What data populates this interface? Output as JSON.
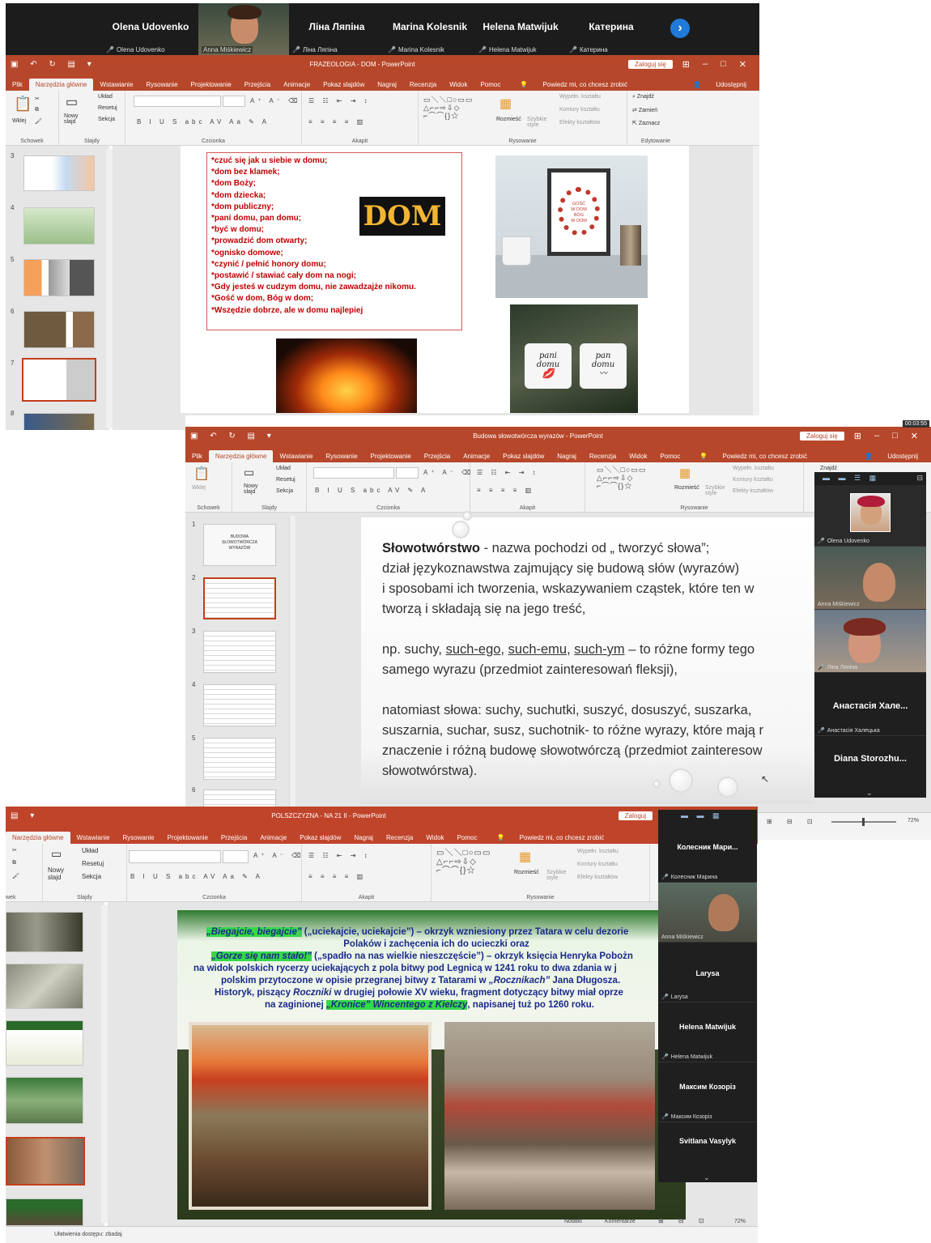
{
  "shot1": {
    "participants": [
      {
        "name": "Olena Udovenko",
        "sub": "Olena Udovenko"
      },
      {
        "name": "",
        "sub": "Anna Miśkiewicz"
      },
      {
        "name": "Ліна Ляпіна",
        "sub": "Ліна Ляпіна"
      },
      {
        "name": "Marina Kolesnik",
        "sub": "Marina Kolesnik"
      },
      {
        "name": "Helena Matwijuk",
        "sub": "Helena Matwijuk"
      },
      {
        "name": "Катерина",
        "sub": "Катерина"
      }
    ],
    "next_icon": "chevron-right-icon",
    "window_title": "FRAZEOLOGIA - DOM  -  PowerPoint",
    "login": "Zaloguj się",
    "tabs": [
      "Plik",
      "Narzędzia główne",
      "Wstawianie",
      "Rysowanie",
      "Projektowanie",
      "Przejścia",
      "Animacje",
      "Pokaz slajdów",
      "Nagraj",
      "Recenzja",
      "Widok",
      "Pomoc"
    ],
    "tell_me": "Powiedz mi, co chcesz zrobić",
    "share": "Udostępnij",
    "groups": {
      "clipboard": "Schowek",
      "slides": "Slajdy",
      "font": "Czcionka",
      "paragraph": "Akapit",
      "drawing": "Rysowanie",
      "editing": "Edytowanie"
    },
    "ribbon_items": {
      "paste": "Wklej",
      "new_slide": "Nowy slajd",
      "layout": "Układ",
      "reset": "Resetuj",
      "section": "Sekcja",
      "arrange": "Rozmieść",
      "quick_styles": "Szybkie style",
      "fill": "Wypełn. kształtu",
      "outline": "Kontury kształtu",
      "effects": "Efekty kształtów",
      "find": "Znajdź",
      "replace": "Zamień",
      "select": "Zaznacz"
    },
    "thumb_numbers": [
      "3",
      "4",
      "5",
      "6",
      "7",
      "8"
    ],
    "slide": {
      "phrases": [
        "*czuć się jak u siebie w domu;",
        "*dom bez klamek;",
        "*dom Boży;",
        "*dom dziecka;",
        "*dom publiczny;",
        "*pani domu, pan domu;",
        "*być w domu;",
        "*prowadzić dom otwarty;",
        "*ognisko domowe;",
        "*czynić / pełnić honory domu;",
        "*postawić / stawiać cały dom na nogi;",
        "*Gdy jesteś w cudzym domu, nie zawadzajże nikomu.",
        "*Gość w dom, Bóg w dom;",
        "*Wszędzie dobrze, ale w domu najlepiej"
      ],
      "logo": "DOM",
      "frame_text": [
        "GOŚĆ",
        "W DOM",
        "BÓG",
        "W DOM"
      ],
      "mug_left": [
        "pani",
        "domu"
      ],
      "mug_right": [
        "pan",
        "domu"
      ]
    }
  },
  "shot2": {
    "timer": "00:03:55",
    "window_title": "Budowa słowotwórcza wyrazów  -  PowerPoint",
    "login": "Zaloguj się",
    "tabs": [
      "Plik",
      "Narzędzia główne",
      "Wstawianie",
      "Rysowanie",
      "Projektowanie",
      "Przejścia",
      "Animacje",
      "Pokaz slajdów",
      "Nagraj",
      "Recenzja",
      "Widok",
      "Pomoc"
    ],
    "tell_me": "Powiedz mi, co chcesz zrobić",
    "share": "Udostępnij",
    "groups": {
      "clipboard": "Schowek",
      "slides": "Slajdy",
      "font": "Czcionka",
      "paragraph": "Akapit",
      "drawing": "Rysowanie"
    },
    "ribbon_items": {
      "paste": "Wklej",
      "new_slide": "Nowy slajd",
      "layout": "Układ",
      "reset": "Resetuj",
      "section": "Sekcja",
      "arrange": "Rozmieść",
      "quick_styles": "Szybkie style",
      "fill": "Wypełn. kształtu",
      "outline": "Kontury kształtu",
      "effects": "Efekty kształtów",
      "find": "Znajdź"
    },
    "thumb_numbers": [
      "1",
      "2",
      "3",
      "4",
      "5",
      "6"
    ],
    "thumb1_lines": [
      "BUDOWA",
      "SŁOWOTWÓRCZA",
      "WYRAZÓW"
    ],
    "slide": {
      "term": "Słowotwórstwo",
      "lines": [
        " - nazwa pochodzi od „ tworzyć słowa”;",
        "dział językoznawstwa zajmujący się budową słów (wyrazów)",
        "i sposobami ich tworzenia, wskazywaniem cząstek, które ten w",
        "tworzą i składają się na jego treść,",
        "",
        "np. suchy, ",
        "samego wyrazu (przedmiot zainteresowań fleksji),",
        "",
        "natomiast słowa: suchy, suchutki, suszyć, dosuszyć, suszarka,",
        "suszarnia, suchar, susz, suchotnik- to różne wyrazy, które mają r",
        "znaczenie i różną budowę słowotwórczą (przedmiot zainteresow",
        "słowotwórstwa)."
      ],
      "underlined": [
        "such-ego",
        "such-emu",
        "such-ym"
      ],
      "after_underlined": " – to różne formy tego"
    },
    "zoom": [
      {
        "name": "",
        "sub": "Olena Udovenko"
      },
      {
        "name": "",
        "sub": "Anna Miśkiewicz"
      },
      {
        "name": "",
        "sub": "Ліна Ляпіна"
      },
      {
        "name": "Анастасія Хале...",
        "sub": "Анастасія Халецька"
      },
      {
        "name": "Diana Storozhu...",
        "sub": ""
      }
    ],
    "zoom_percent": "72%"
  },
  "shot3": {
    "window_title": "POLSZCZYZNA - NA 21 II  -  PowerPoint",
    "login": "Zaloguj",
    "tabs": [
      "Narzędzia główne",
      "Wstawianie",
      "Rysowanie",
      "Projektowanie",
      "Przejścia",
      "Animacje",
      "Pokaz slajdów",
      "Nagraj",
      "Recenzja",
      "Widok",
      "Pomoc"
    ],
    "tell_me": "Powiedz mi, co chcesz zrobić",
    "groups": {
      "clipboard": "wek",
      "slides": "Slajdy",
      "font": "Czcionka",
      "paragraph": "Akapit",
      "drawing": "Rysowanie"
    },
    "ribbon_items": {
      "new_slide": "Nowy slajd",
      "layout": "Układ",
      "reset": "Resetuj",
      "section": "Sekcja",
      "arrange": "Rozmieść",
      "quick_styles": "Szybkie style",
      "fill": "Wypełn. kształtu",
      "outline": "Kontury kształtu",
      "effects": "Efekty kształtów"
    },
    "slide": {
      "hl1": "„Biegajcie, biegajcie”",
      "t1": " („uciekajcie, uciekajcie”) – okrzyk wzniesiony przez Tatara w celu dezorie",
      "t2": "Polaków i zachęcenia ich do ucieczki oraz",
      "hl2": "„Gorze się nam stało!”",
      "t3": " („spadło na nas wielkie nieszczęście”) – okrzyk księcia Henryka Pobożn",
      "t4": "na widok polskich rycerzy uciekających z pola bitwy pod Legnicą w 1241 roku to dwa zdania w j",
      "t5a": "polskim przytoczone w opisie przegranej bitwy z Tatarami w ",
      "t5b": "„Rocznikach”",
      "t5c": " Jana Długosza.",
      "t6a": "Historyk, piszący ",
      "t6b": "Roczniki",
      "t6c": " w drugiej połowie XV wieku, fragment dotyczący bitwy miał oprze",
      "t7a": "na zaginionej ",
      "hl3": "„Kronice” Wincentego z Kielczy",
      "t7b": ", napisanej tuż po 1260 roku."
    },
    "zoom": [
      {
        "name": "Колесник Мари...",
        "sub": "Колесник Марина"
      },
      {
        "name": "",
        "sub": "Anna Miśkiewicz"
      },
      {
        "name": "Larysa",
        "sub": "Larysa"
      },
      {
        "name": "Helena Matwijuk",
        "sub": "Helena Matwijuk"
      },
      {
        "name": "Максим Козоріз",
        "sub": "Максим Козоріз"
      },
      {
        "name": "Svitlana Vasylyk",
        "sub": ""
      }
    ],
    "status": {
      "notes": "Notatki",
      "comments": "Komentarze",
      "zoom": "72%",
      "accessibility": "Ułatwienia dostępu: zbadaj"
    }
  }
}
